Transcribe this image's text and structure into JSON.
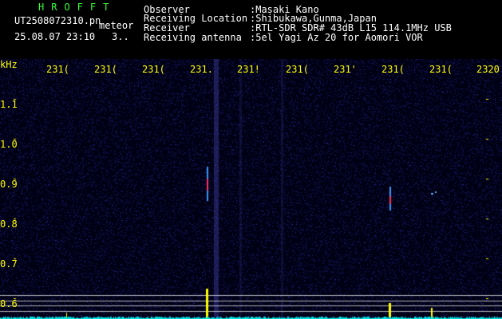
{
  "header": {
    "station_name": "HROFFT",
    "filename": "UT2508072310.pn",
    "tag": "meteor",
    "datetime": "25.08.07 23:10",
    "count": "3..",
    "info_labels": [
      "Observer",
      "Receiving Location",
      "Receiver",
      "Receiving antenna"
    ],
    "info_values": [
      ":Masaki Kano",
      ":Shibukawa,Gunma,Japan",
      ":RTL-SDR SDR# 43dB L15 114.1MHz USB",
      ":5el Yagi Az 20 for Aomori VOR"
    ]
  },
  "axis": {
    "unit": "kHz",
    "x_ticks": [
      "231(",
      "231(",
      "231(",
      "231.",
      "231!",
      "231(",
      "231'",
      "231(",
      "231(",
      "2320"
    ],
    "y_ticks": [
      "1.1",
      "1.0",
      "0.9",
      "0.8",
      "0.7",
      "0.6"
    ]
  },
  "colors": {
    "label": "#ffff00",
    "title": "#33ff33",
    "background": "#00001a"
  }
}
